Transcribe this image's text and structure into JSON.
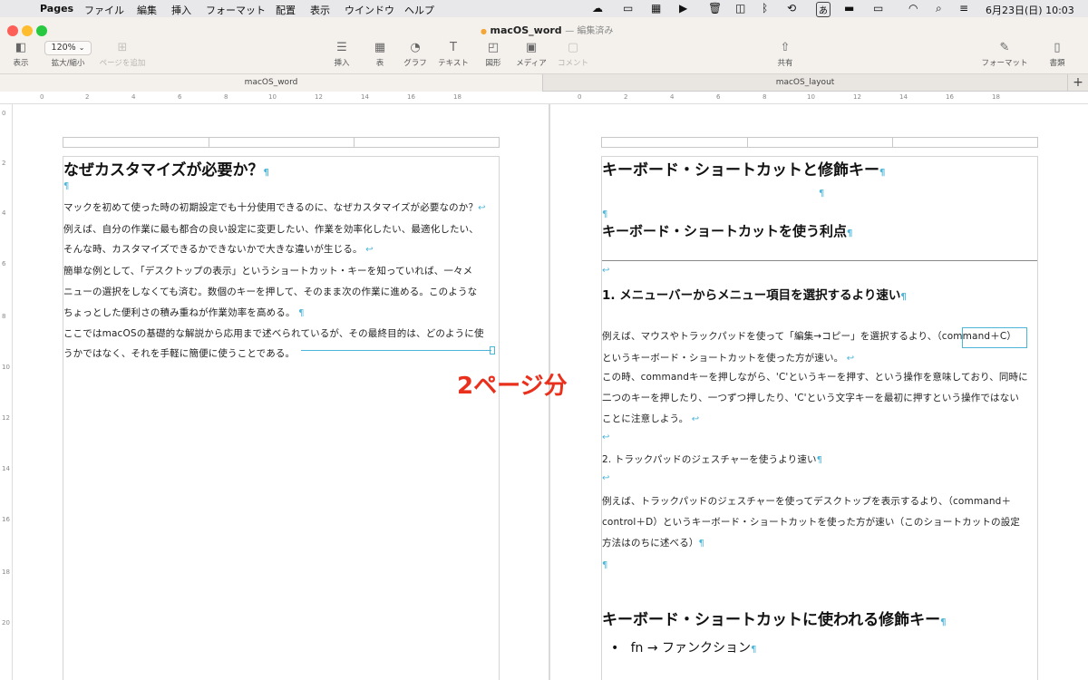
{
  "menubar": {
    "app_name": "Pages",
    "items": [
      "ファイル",
      "編集",
      "挿入",
      "フォーマット",
      "配置",
      "表示",
      "ウインドウ",
      "ヘルプ"
    ],
    "ime": "あ",
    "datetime": "6月23日(日)  10:03"
  },
  "window": {
    "title": "macOS_word",
    "title_suffix": "— 編集済み",
    "zoom": "120%"
  },
  "toolbar": {
    "view": "表示",
    "zoom": "拡大/縮小",
    "add_page": "ページを追加",
    "insert": "挿入",
    "table": "表",
    "chart": "グラフ",
    "text": "テキスト",
    "shape": "図形",
    "media": "メディア",
    "comment": "コメント",
    "share": "共有",
    "format": "フォーマット",
    "document": "書類"
  },
  "tabs": [
    "macOS_word",
    "macOS_layout"
  ],
  "ruler": {
    "left": [
      "0",
      "2",
      "4",
      "6",
      "8",
      "10",
      "12",
      "14",
      "16",
      "18"
    ],
    "right": [
      "0",
      "2",
      "4",
      "6",
      "8",
      "10",
      "12",
      "14",
      "16",
      "18"
    ],
    "vertical": [
      "0",
      "2",
      "4",
      "6",
      "8",
      "10",
      "12",
      "14",
      "16",
      "18",
      "20"
    ]
  },
  "left_doc": {
    "heading": "なぜカスタマイズが必要か？",
    "lines": [
      "マックを初めて使った時の初期設定でも十分使用できるのに、なぜカスタマイズが必要なのか？",
      "例えば、自分の作業に最も都合の良い設定に変更したい、作業を効率化したい、最適化したい、",
      "そんな時、カスタマイズできるかできないかで大きな違いが生じる。",
      "簡単な例として、「デスクトップの表示」というショートカット・キーを知っていれば、一々メ",
      "ニューの選択をしなくても済む。数個のキーを押して、そのまま次の作業に進める。このような",
      "ちょっとした便利さの積み重ねが作業効率を高める。",
      "ここではmacOSの基礎的な解説から応用まで述べられているが、その最終目的は、どのように使",
      "うかではなく、それを手軽に簡便に使うことである。"
    ]
  },
  "right_doc": {
    "title": "キーボード・ショートカットと修飾キー",
    "heading2": "キーボード・ショートカットを使う利点",
    "sub1": "1. メニューバーからメニュー項目を選択するより速い",
    "sub1_lines": [
      "例えば、マウスやトラックパッドを使って「編集→コピー」を選択するより、（command＋C）",
      "というキーボード・ショートカットを使った方が速い。"
    ],
    "sub1_lines2": [
      "この時、commandキーを押しながら、'C'というキーを押す、という操作を意味しており、同時に",
      "二つのキーを押したり、一つずつ押したり、'C'という文字キーを最初に押すという操作ではない",
      "ことに注意しよう。"
    ],
    "sub2": "2. トラックパッドのジェスチャーを使うより速い",
    "sub2_lines": [
      "例えば、トラックパッドのジェスチャーを使ってデスクトップを表示するより、（command＋",
      "control＋D）というキーボード・ショートカットを使った方が速い（このショートカットの設定",
      "方法はのちに述べる）"
    ],
    "heading3": "キーボード・ショートカットに使われる修飾キー",
    "bullet1": "fn → ファンクション"
  },
  "annotation": "2ページ分",
  "colors": {
    "accent": "#4cb5d8",
    "annotation": "#e8301c",
    "close": "#fe5f57",
    "minimize": "#febc2e",
    "zoom": "#28c840"
  }
}
